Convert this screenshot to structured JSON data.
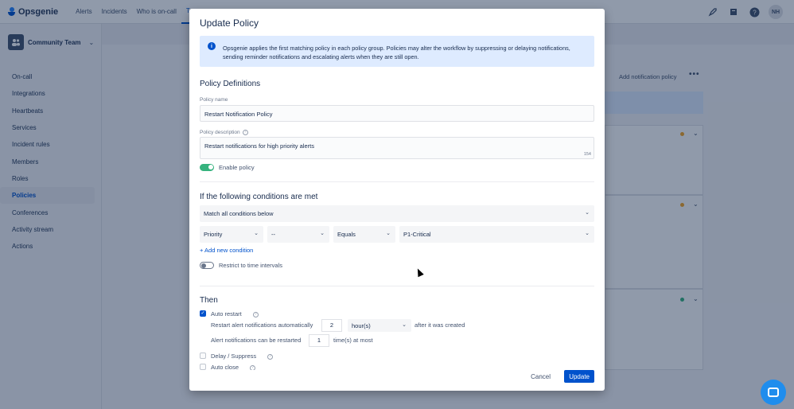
{
  "app": {
    "name": "Opsgenie"
  },
  "nav": {
    "links": [
      "Alerts",
      "Incidents",
      "Who is on-call",
      "Teams"
    ],
    "active_index": 3,
    "user_initials": "NH"
  },
  "sidebar": {
    "team_name": "Community Team",
    "items": [
      {
        "label": "On-call"
      },
      {
        "label": "Integrations"
      },
      {
        "label": "Heartbeats"
      },
      {
        "label": "Services"
      },
      {
        "label": "Incident rules"
      },
      {
        "label": "Members"
      },
      {
        "label": "Roles"
      },
      {
        "label": "Policies",
        "active": true
      },
      {
        "label": "Conferences"
      },
      {
        "label": "Activity stream"
      },
      {
        "label": "Actions"
      }
    ]
  },
  "background": {
    "add_policy_label": "Add notification policy",
    "more_label": "•••",
    "status_colors": [
      "#f6a623",
      "#f6a623",
      "#36b37e"
    ]
  },
  "modal": {
    "title": "Update Policy",
    "info_text": "Opsgenie applies the first matching policy in each policy group. Policies may alter the workflow by suppressing or delaying notifications, sending reminder notifications and escalating alerts when they are still open.",
    "definitions": {
      "heading": "Policy Definitions",
      "name_label": "Policy name",
      "name_value": "Restart Notification Policy",
      "desc_label": "Policy description",
      "desc_value": "Restart notifications for high priority alerts",
      "desc_counter": "154",
      "enable_label": "Enable policy"
    },
    "conditions": {
      "heading": "If the following conditions are met",
      "match_value": "Match all conditions below",
      "field_value": "Priority",
      "not_value": "--",
      "operator_value": "Equals",
      "value_value": "P1-Critical",
      "add_condition_label": "+ Add new condition",
      "restrict_label": "Restrict to time intervals"
    },
    "then": {
      "heading": "Then",
      "auto_restart_label": "Auto restart",
      "restart_prefix": "Restart alert notifications automatically",
      "restart_amount": "2",
      "restart_unit": "hour(s)",
      "restart_suffix": "after it was created",
      "restart_count_prefix": "Alert notifications can be restarted",
      "restart_count": "1",
      "restart_count_suffix": "time(s) at most",
      "delay_label": "Delay / Suppress",
      "auto_close_label": "Auto close"
    },
    "cancel_label": "Cancel",
    "update_label": "Update"
  }
}
